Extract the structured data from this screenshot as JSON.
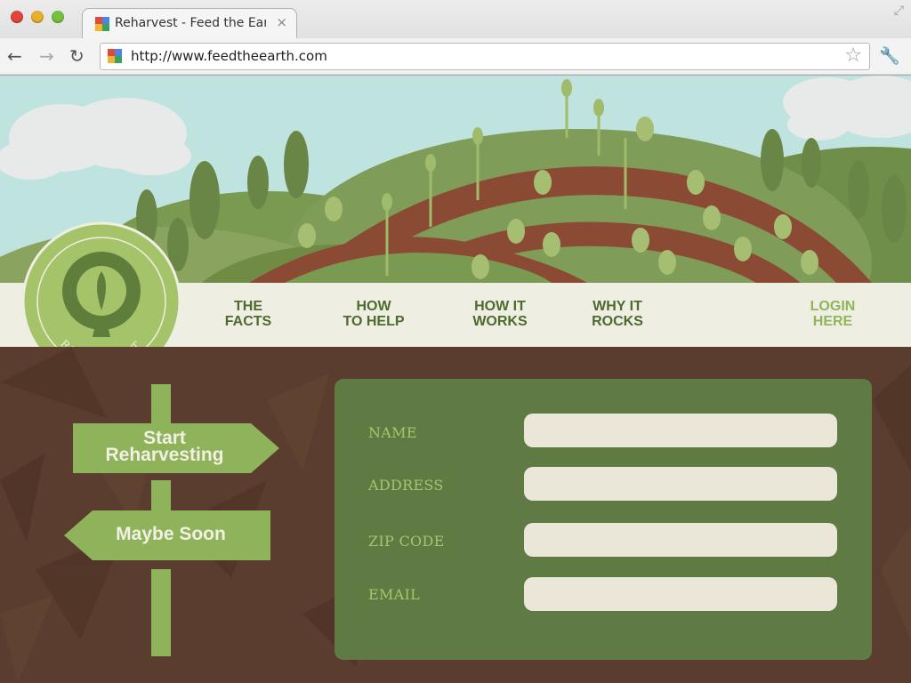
{
  "browser": {
    "tab_title": "Reharvest - Feed the Ear...",
    "tab_close": "×",
    "url": "http://www.feedtheearth.com",
    "star": "☆",
    "wrench": "🔧",
    "back": "←",
    "forward": "→",
    "reload": "↻",
    "resize": "⤢"
  },
  "logo": {
    "text": "REHARVEST"
  },
  "nav": {
    "facts": [
      "THE",
      "FACTS"
    ],
    "help": [
      "HOW",
      "TO HELP"
    ],
    "works": [
      "HOW IT",
      "WORKS"
    ],
    "rocks": [
      "WHY IT",
      "ROCKS"
    ],
    "login": [
      "LOGIN",
      "HERE"
    ]
  },
  "signs": {
    "start": [
      "Start",
      "Reharvesting"
    ],
    "maybe": "Maybe Soon"
  },
  "form": {
    "name_label": "NAME",
    "address_label": "ADDRESS",
    "zip_label": "ZIP CODE",
    "email_label": "EMAIL",
    "name_value": "",
    "address_value": "",
    "zip_value": "",
    "email_value": ""
  },
  "colors": {
    "sky": "#bfe3de",
    "nav_bg": "#efeee2",
    "nav_text": "#4d6a2f",
    "login_text": "#8fb65a",
    "soil": "#5a3d2e",
    "form_bg": "#607a43",
    "sign": "#8fb35b"
  }
}
